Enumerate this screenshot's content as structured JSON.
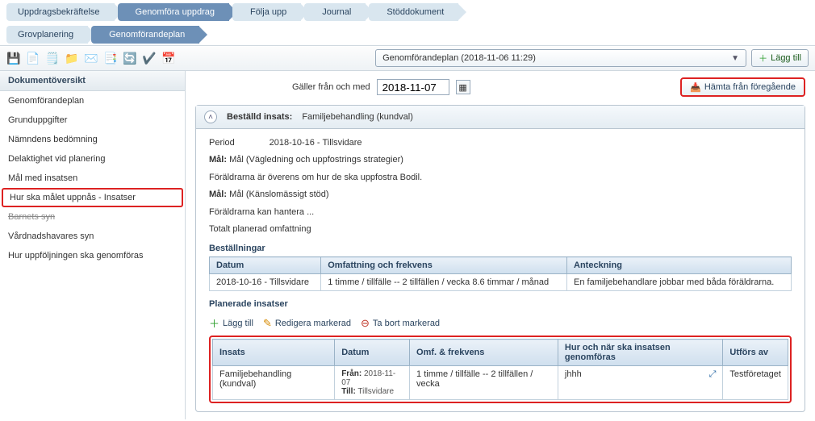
{
  "breadcrumbs_top": [
    {
      "label": "Uppdragsbekräftelse",
      "active": false
    },
    {
      "label": "Genomföra uppdrag",
      "active": true
    },
    {
      "label": "Följa upp",
      "active": false
    },
    {
      "label": "Journal",
      "active": false
    },
    {
      "label": "Stöddokument",
      "active": false
    }
  ],
  "breadcrumbs_sub": [
    {
      "label": "Grovplanering",
      "active": false
    },
    {
      "label": "Genomförandeplan",
      "active": true
    }
  ],
  "toolbar": {
    "file_icon": "file-icon",
    "doc_select_label": "Genomförandeplan (2018-11-06 11:29)",
    "add_label": "Lägg till"
  },
  "sidebar": {
    "title": "Dokumentöversikt",
    "items": [
      {
        "label": "Genomförandeplan",
        "highlight": false
      },
      {
        "label": "Grunduppgifter",
        "highlight": false
      },
      {
        "label": "Nämndens bedömning",
        "highlight": false
      },
      {
        "label": "Delaktighet vid planering",
        "highlight": false
      },
      {
        "label": "Mål med insatsen",
        "highlight": false
      },
      {
        "label": "Hur ska målet uppnås - Insatser",
        "highlight": true
      },
      {
        "label": "Barnets syn",
        "highlight": false,
        "striked": true
      },
      {
        "label": "Vårdnadshavares syn",
        "highlight": false
      },
      {
        "label": "Hur uppföljningen ska genomföras",
        "highlight": false
      }
    ]
  },
  "header": {
    "valid_from_label": "Gäller från och med",
    "valid_from_value": "2018-11-07",
    "fetch_prev_label": "Hämta från föregående"
  },
  "panel": {
    "ordered_label": "Beställd insats:",
    "ordered_value": "Familjebehandling (kundval)",
    "period_label": "Period",
    "period_value": "2018-10-16 - Tillsvidare",
    "mal1_label": "Mål:",
    "mal1_value": "Mål (Vägledning och uppfostrings strategier)",
    "mal1_desc": "Föräldrarna är överens om hur de ska uppfostra Bodil.",
    "mal2_label": "Mål:",
    "mal2_value": "Mål (Känslomässigt stöd)",
    "mal2_desc": "Föräldrarna kan hantera ...",
    "total_label": "Totalt planerad omfattning"
  },
  "bestallningar": {
    "title": "Beställningar",
    "columns": [
      "Datum",
      "Omfattning och frekvens",
      "Anteckning"
    ],
    "rows": [
      {
        "datum": "2018-10-16 - Tillsvidare",
        "omf": "1 timme / tillfälle -- 2 tillfällen / vecka 8.6 timmar / månad",
        "ant": "En familjebehandlare jobbar med båda föräldrarna."
      }
    ]
  },
  "planerade": {
    "title": "Planerade insatser",
    "actions": {
      "add": "Lägg till",
      "edit": "Redigera markerad",
      "del": "Ta bort markerad"
    },
    "columns": [
      "Insats",
      "Datum",
      "Omf. & frekvens",
      "Hur och när ska insatsen genomföras",
      "Utförs av"
    ],
    "rows": [
      {
        "insats": "Familjebehandling (kundval)",
        "datum_from_label": "Från:",
        "datum_from": "2018-11-07",
        "datum_to_label": "Till:",
        "datum_to": "Tillsvidare",
        "omf": "1 timme / tillfälle -- 2 tillfällen / vecka",
        "hur": "jhhh",
        "utfors": "Testföretaget"
      }
    ]
  }
}
